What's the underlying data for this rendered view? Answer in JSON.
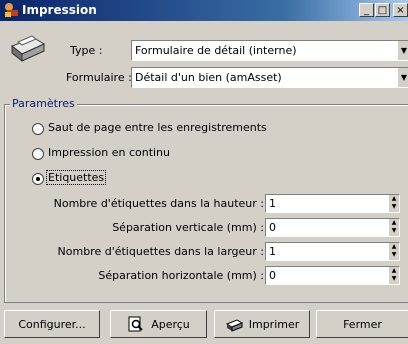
{
  "window": {
    "title": "Impression",
    "controls": {
      "minimize": "_",
      "maximize": "□",
      "close": "×"
    }
  },
  "form": {
    "type_label": "Type :",
    "type_value": "Formulaire de détail (interne)",
    "formulaire_label": "Formulaire :",
    "formulaire_value": "Détail d'un bien (amAsset)"
  },
  "parametres": {
    "title": "Paramètres",
    "options": [
      {
        "label": "Saut de page entre les enregistrements",
        "selected": false
      },
      {
        "label": "Impression en continu",
        "selected": false
      },
      {
        "label": "Etiquettes",
        "selected": true
      }
    ],
    "fields": [
      {
        "label": "Nombre d'étiquettes dans la hauteur :",
        "value": "1"
      },
      {
        "label": "Séparation verticale (mm) :",
        "value": "0"
      },
      {
        "label": "Nombre d'étiquettes dans la largeur :",
        "value": "1"
      },
      {
        "label": "Séparation horizontale (mm) :",
        "value": "0"
      }
    ]
  },
  "buttons": {
    "configurer": "Configurer...",
    "apercu": "Aperçu",
    "imprimer": "Imprimer",
    "fermer": "Fermer"
  }
}
